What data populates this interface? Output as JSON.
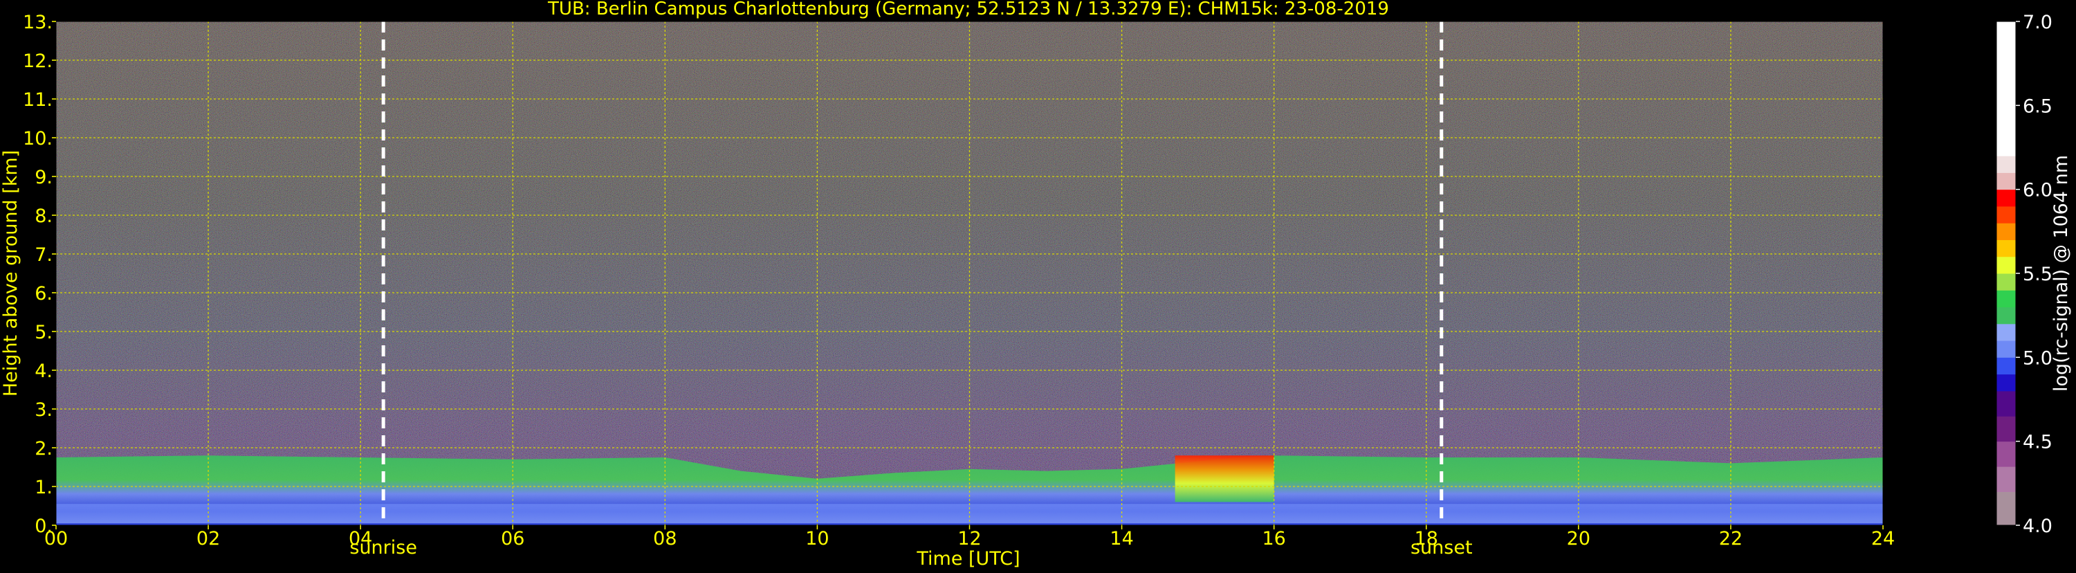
{
  "chart_data": {
    "type": "heatmap",
    "title": "TUB: Berlin Campus Charlottenburg (Germany; 52.5123 N / 13.3279 E):    CHM15k: 23-08-2019",
    "xlabel": "Time [UTC]",
    "ylabel": "Height above ground [km]",
    "colorbar_label": "log(rc-signal) @ 1064 nm",
    "xlim": [
      0,
      24
    ],
    "ylim": [
      0,
      13
    ],
    "x_ticks": [
      0,
      2,
      4,
      6,
      8,
      10,
      12,
      14,
      16,
      18,
      20,
      22,
      24
    ],
    "x_tick_labels": [
      "00",
      "02",
      "04",
      "06",
      "08",
      "10",
      "12",
      "14",
      "16",
      "18",
      "20",
      "22",
      "24"
    ],
    "y_ticks": [
      0,
      1,
      2,
      3,
      4,
      5,
      6,
      7,
      8,
      9,
      10,
      11,
      12,
      13
    ],
    "y_tick_labels": [
      "0.",
      "1.",
      "2.",
      "3.",
      "4.",
      "5.",
      "6.",
      "7.",
      "8.",
      "9.",
      "10.",
      "11.",
      "12.",
      "13."
    ],
    "grid": true,
    "colorbar_range": [
      4.0,
      7.0
    ],
    "colorbar_ticks": [
      4.0,
      4.5,
      5.0,
      5.5,
      6.0,
      6.5,
      7.0
    ],
    "colorbar_tick_labels": [
      "4.0",
      "4.5",
      "5.0",
      "5.5",
      "6.0",
      "6.5",
      "7.0"
    ],
    "colorbar_colors": [
      {
        "from": 4.0,
        "to": 4.2,
        "color": "#a8909c"
      },
      {
        "from": 4.2,
        "to": 4.35,
        "color": "#b07aa8"
      },
      {
        "from": 4.35,
        "to": 4.5,
        "color": "#9a4e98"
      },
      {
        "from": 4.5,
        "to": 4.65,
        "color": "#6f1e80"
      },
      {
        "from": 4.65,
        "to": 4.8,
        "color": "#520a8a"
      },
      {
        "from": 4.8,
        "to": 4.9,
        "color": "#1f10c8"
      },
      {
        "from": 4.9,
        "to": 5.0,
        "color": "#3550f0"
      },
      {
        "from": 5.0,
        "to": 5.1,
        "color": "#6f8af5"
      },
      {
        "from": 5.1,
        "to": 5.2,
        "color": "#90a8f8"
      },
      {
        "from": 5.2,
        "to": 5.3,
        "color": "#3ec060"
      },
      {
        "from": 5.3,
        "to": 5.4,
        "color": "#30d050"
      },
      {
        "from": 5.4,
        "to": 5.5,
        "color": "#9ee04a"
      },
      {
        "from": 5.5,
        "to": 5.6,
        "color": "#e8ff30"
      },
      {
        "from": 5.6,
        "to": 5.7,
        "color": "#ffc800"
      },
      {
        "from": 5.7,
        "to": 5.8,
        "color": "#ff9000"
      },
      {
        "from": 5.8,
        "to": 5.9,
        "color": "#ff4000"
      },
      {
        "from": 5.9,
        "to": 6.0,
        "color": "#ff0000"
      },
      {
        "from": 6.0,
        "to": 6.1,
        "color": "#e8b8b8"
      },
      {
        "from": 6.1,
        "to": 6.2,
        "color": "#f0e0e0"
      },
      {
        "from": 6.2,
        "to": 7.0,
        "color": "#ffffff"
      }
    ],
    "annotations": [
      {
        "x": 4.3,
        "label": "sunrise"
      },
      {
        "x": 18.2,
        "label": "sunset"
      }
    ],
    "boundary_layer": {
      "description_layers": [
        {
          "top_km": [
            1.75,
            1.8,
            1.75,
            1.7,
            1.75,
            1.4,
            1.2,
            1.35,
            1.45,
            1.4,
            1.45,
            1.75,
            1.8,
            1.75,
            1.75,
            1.6,
            1.75
          ],
          "time_h": [
            0,
            2,
            4,
            6,
            8,
            9,
            10,
            11,
            12,
            13,
            14,
            15.5,
            16,
            18,
            20,
            22,
            24
          ]
        }
      ]
    },
    "colors": {
      "text": "#ffff00",
      "colorbar_text": "#ffffff",
      "grid": "#d8d800",
      "background": "#000000",
      "sun_line": "#ffffff"
    }
  }
}
